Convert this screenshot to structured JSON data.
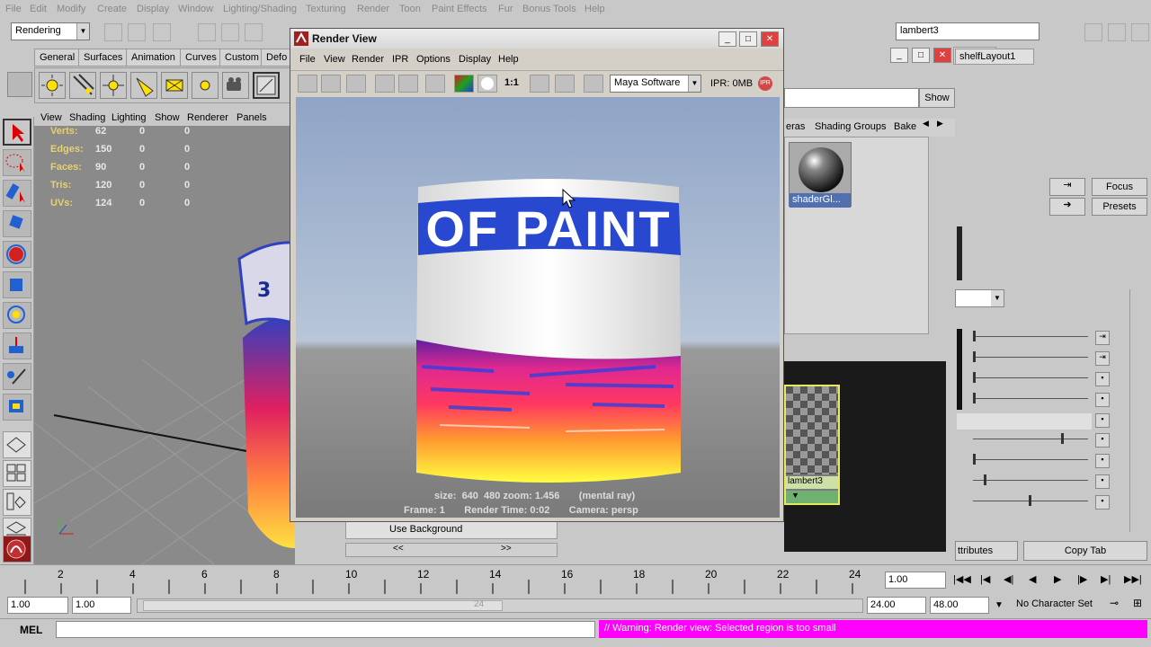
{
  "menubar": {
    "items": [
      "File",
      "Edit",
      "Modify",
      "Create",
      "Display",
      "Window",
      "Lighting/Shading",
      "Texturing",
      "Render",
      "Toon",
      "Paint Effects",
      "Fur",
      "Bonus Tools",
      "Help"
    ]
  },
  "toolbar": {
    "mode": "Rendering",
    "name_field": "lambert3"
  },
  "shelf": {
    "tabs": [
      "General",
      "Surfaces",
      "Animation",
      "Curves",
      "Custom",
      "Defo"
    ],
    "right_tab": "shelfLayout1"
  },
  "viewport": {
    "menu": [
      "View",
      "Shading",
      "Lighting",
      "Show",
      "Renderer",
      "Panels"
    ],
    "hud": [
      {
        "label": "Verts:",
        "v": [
          "62",
          "0",
          "0"
        ]
      },
      {
        "label": "Edges:",
        "v": [
          "150",
          "0",
          "0"
        ]
      },
      {
        "label": "Faces:",
        "v": [
          "90",
          "0",
          "0"
        ]
      },
      {
        "label": "Tris:",
        "v": [
          "120",
          "0",
          "0"
        ]
      },
      {
        "label": "UVs:",
        "v": [
          "124",
          "0",
          "0"
        ]
      }
    ]
  },
  "render_view": {
    "title": "Render View",
    "menu": [
      "File",
      "View",
      "Render",
      "IPR",
      "Options",
      "Display",
      "Help"
    ],
    "renderer": "Maya Software",
    "ratio": "1:1",
    "ipr": "IPR: 0MB",
    "label_text": "OF PAINT",
    "stats_line1": "size:  640  480 zoom: 1.456       (mental ray)",
    "stats_line2": "Frame: 1       Render Time: 0:02       Camera: persp"
  },
  "hypershade": {
    "tabs": [
      "eras",
      "Shading Groups",
      "Bake"
    ],
    "material": "shaderGl...",
    "node": "lambert3",
    "show_btn": "Show",
    "bg_field": "Use Background"
  },
  "attr": {
    "focus": "Focus",
    "presets": "Presets",
    "attributes": "ttributes",
    "copy_tab": "Copy Tab"
  },
  "timeline": {
    "ticks": [
      "2",
      "4",
      "6",
      "8",
      "10",
      "12",
      "14",
      "16",
      "18",
      "20",
      "22",
      "24"
    ],
    "current": "1.00"
  },
  "range": {
    "start": "1.00",
    "start2": "1.00",
    "marker": "24",
    "end": "24.00",
    "end2": "48.00",
    "char_set": "No Character Set"
  },
  "cmd": {
    "label": "MEL",
    "warning": "// Warning: Render view: Selected region is too small"
  }
}
